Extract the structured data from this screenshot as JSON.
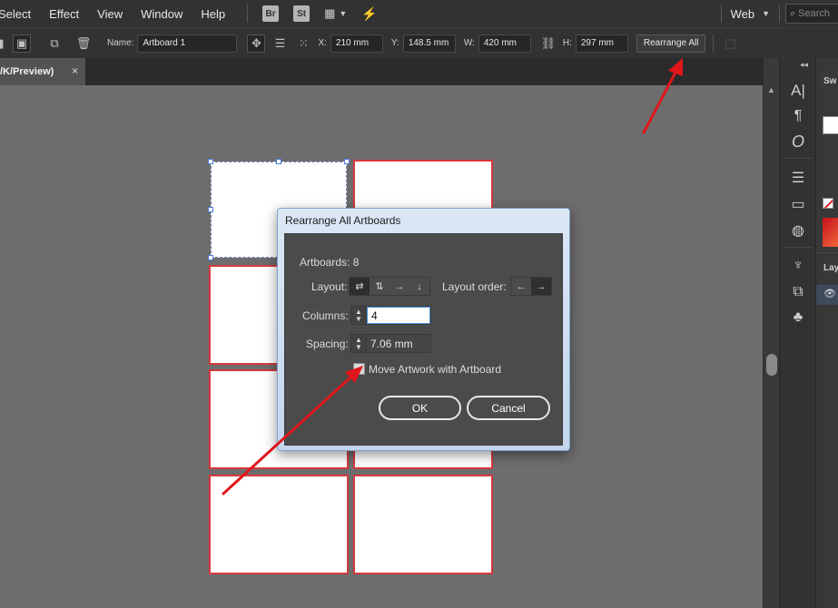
{
  "menubar": {
    "items": [
      "Select",
      "Effect",
      "View",
      "Window",
      "Help"
    ],
    "bridge_badge": "Br",
    "stock_badge": "St",
    "workspace": "Web",
    "search_placeholder": "Search"
  },
  "controlbar": {
    "name_label": "Name:",
    "name_value": "Artboard 1",
    "x_label": "X:",
    "x_value": "210 mm",
    "y_label": "Y:",
    "y_value": "148.5 mm",
    "w_label": "W:",
    "w_value": "420 mm",
    "h_label": "H:",
    "h_value": "297 mm",
    "rearrange_label": "Rearrange All"
  },
  "document_tab": {
    "label": "/K/Preview)",
    "close": "×"
  },
  "right_panel": {
    "tab_top": "Sw",
    "tab_layers": "Lay"
  },
  "dialog": {
    "title": "Rearrange All Artboards",
    "artboards_label": "Artboards: 8",
    "layout_label": "Layout:",
    "layout_order_label": "Layout order:",
    "columns_label": "Columns:",
    "columns_value": "4",
    "spacing_label": "Spacing:",
    "spacing_value": "7.06 mm",
    "move_artwork_label": "Move Artwork with Artboard",
    "ok_label": "OK",
    "cancel_label": "Cancel"
  },
  "colors": {
    "artboard_border": "#d7383d",
    "annotation_arrow": "#e0161b",
    "dialog_frame": "#c4d6ec"
  }
}
